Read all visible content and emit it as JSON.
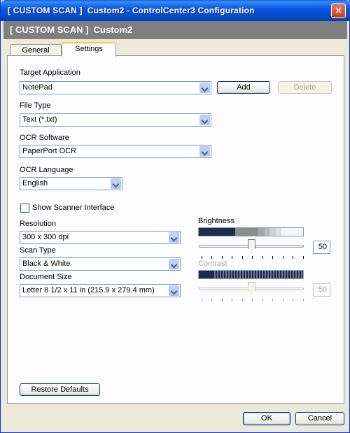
{
  "window": {
    "title": "[ CUSTOM SCAN ]  Custom2 - ControlCenter3 Configuration",
    "close_glyph": "✕"
  },
  "header": {
    "text": "[ CUSTOM SCAN ]  Custom2"
  },
  "tabs": [
    {
      "label": "General",
      "active": false
    },
    {
      "label": "Settings",
      "active": true
    }
  ],
  "target_application": {
    "label": "Target Application",
    "value": "NotePad",
    "add_label": "Add",
    "delete_label": "Delete"
  },
  "file_type": {
    "label": "File Type",
    "value": "Text (*.txt)"
  },
  "ocr_software": {
    "label": "OCR Software",
    "value": "PaperPort OCR"
  },
  "ocr_language": {
    "label": "OCR Language",
    "value": "English"
  },
  "show_scanner_interface": {
    "label": "Show Scanner Interface",
    "checked": false
  },
  "resolution": {
    "label": "Resolution",
    "value": "300 x 300 dpi"
  },
  "scan_type": {
    "label": "Scan Type",
    "value": "Black & White"
  },
  "document_size": {
    "label": "Document Size",
    "value": "Letter 8 1/2 x 11 in (215.9 x 279.4 mm)"
  },
  "brightness": {
    "label": "Brightness",
    "value": "50",
    "enabled": true
  },
  "contrast": {
    "label": "Contrast",
    "value": "50",
    "enabled": false
  },
  "restore_defaults_label": "Restore Defaults",
  "ok_label": "OK",
  "cancel_label": "Cancel",
  "colors": {
    "titlebar": "#0a58e0",
    "dialog_bg": "#ece9d8",
    "header_band": "#7f7f7f",
    "panel_bg": "#fcfcfe"
  }
}
